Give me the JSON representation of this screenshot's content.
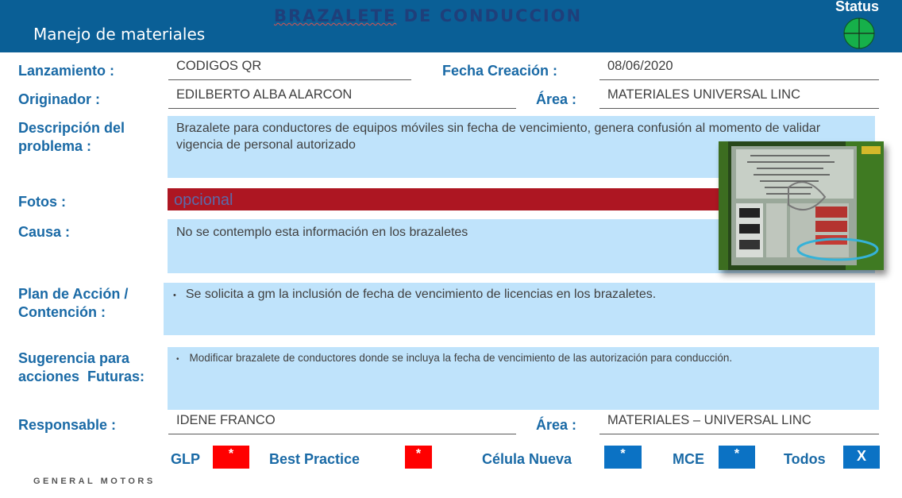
{
  "header": {
    "doc_title_part1": "BRAZALETE",
    "doc_title_part2": " DE CONDUCCION",
    "app_title": "Manejo de materiales",
    "status_label": "Status",
    "status_color": "#16b04a"
  },
  "form": {
    "lanzamiento_label": "Lanzamiento :",
    "lanzamiento_value": "CODIGOS QR",
    "fecha_label": "Fecha Creación :",
    "fecha_value": "08/06/2020",
    "originador_label": "Originador :",
    "originador_value": "EDILBERTO ALBA ALARCON",
    "area1_label": "Área :",
    "area1_value": "MATERIALES UNIVERSAL LINC",
    "descripcion_label_1": "Descripción del",
    "descripcion_label_2": "problema :",
    "descripcion_line_1": "Brazalete para conductores de equipos móviles sin fecha de vencimiento, genera confusión al momento de validar",
    "descripcion_line_2": "vigencia de personal autorizado",
    "fotos_label": "Fotos :",
    "fotos_value": "opcional",
    "causa_label": "Causa :",
    "causa_value": "No se contemplo esta información en los brazaletes",
    "plan_label_1": "Plan de Acción /",
    "plan_label_2": "Contención :",
    "plan_bullet": "Se solicita a gm la inclusión de fecha de vencimiento de licencias en los brazaletes.",
    "sugerencia_label_1": "Sugerencia para",
    "sugerencia_label_2": "acciones  Futuras:",
    "sugerencia_bullet": "Modificar brazalete de conductores donde se incluya la fecha de vencimiento de las autorización para conducción.",
    "responsable_label": "Responsable :",
    "responsable_value": "IDENE FRANCO",
    "area2_label": "Área :",
    "area2_value": "MATERIALES – UNIVERSAL LINC"
  },
  "footer": {
    "glp_label": "GLP",
    "glp_mark": "*",
    "best_label": "Best Practice",
    "best_mark": "*",
    "celula_label": "Célula Nueva",
    "celula_mark": "*",
    "mce_label": "MCE",
    "mce_mark": "*",
    "todos_label": "Todos",
    "todos_mark": "X",
    "red_color": "#ff0000",
    "blue_color": "#0b72c4",
    "brand": "GENERAL MOTORS"
  }
}
